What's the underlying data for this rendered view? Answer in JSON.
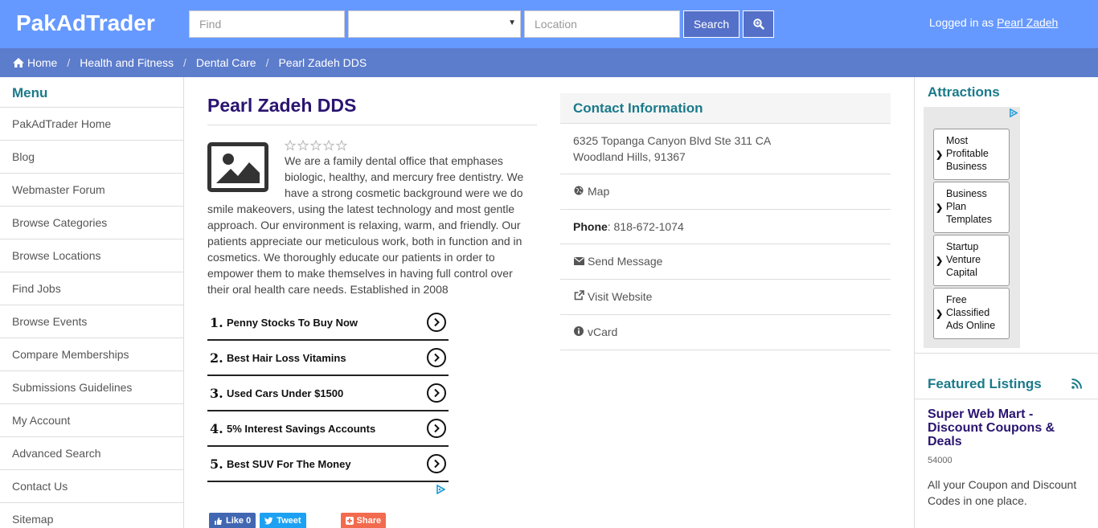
{
  "header": {
    "logo": "PakAdTrader",
    "find_placeholder": "Find",
    "category_selected": "",
    "location_placeholder": "Location",
    "search_label": "Search",
    "login_prefix": "Logged in as",
    "username": "Pearl Zadeh"
  },
  "breadcrumb": [
    "Home",
    "Health and Fitness",
    "Dental Care",
    "Pearl Zadeh DDS"
  ],
  "menu": {
    "title": "Menu",
    "items": [
      "PakAdTrader Home",
      "Blog",
      "Webmaster Forum",
      "Browse Categories",
      "Browse Locations",
      "Find Jobs",
      "Browse Events",
      "Compare Memberships",
      "Submissions Guidelines",
      "My Account",
      "Advanced Search",
      "Contact Us",
      "Sitemap"
    ]
  },
  "listing": {
    "title": "Pearl Zadeh DDS",
    "rating": 0,
    "description": "We are a family dental office that emphases biologic, healthy, and mercury free dentistry. We have a strong cosmetic background were we do smile makeovers, using the latest technology and most gentle approach. Our environment is relaxing, warm, and friendly. Our patients appreciate our meticulous work, both in function and in cosmetics. We thoroughly educate our patients in order to empower them to make themselves in having full control over their oral health care needs. Established in 2008"
  },
  "ads": [
    {
      "num": "1.",
      "label": "Penny Stocks To Buy Now"
    },
    {
      "num": "2.",
      "label": "Best Hair Loss Vitamins"
    },
    {
      "num": "3.",
      "label": "Used Cars Under $1500"
    },
    {
      "num": "4.",
      "label": "5% Interest Savings Accounts"
    },
    {
      "num": "5.",
      "label": "Best SUV For The Money"
    }
  ],
  "social": {
    "like": "Like 0",
    "tweet": "Tweet",
    "share": "Share"
  },
  "contact": {
    "title": "Contact Information",
    "address_line1": "6325 Topanga Canyon Blvd Ste 311 CA",
    "address_line2": "Woodland Hills, 91367",
    "map": "Map",
    "phone_label": "Phone",
    "phone": ": 818-672-1074",
    "message": "Send Message",
    "website": "Visit Website",
    "vcard": "vCard"
  },
  "attractions": {
    "title": "Attractions",
    "items": [
      [
        "Most",
        "Profitable",
        "Business"
      ],
      [
        "Business",
        "Plan",
        "Templates"
      ],
      [
        "Startup",
        "Venture",
        "Capital"
      ],
      [
        "Free",
        "Classified",
        "Ads Online"
      ]
    ]
  },
  "featured": {
    "title": "Featured Listings",
    "name": "Super Web Mart - Discount Coupons & Deals",
    "id": "54000",
    "desc": "All your Coupon and Discount Codes in one place."
  },
  "colors": {
    "topbar": "#6699ff",
    "crumbbar": "#5c7ccc",
    "button": "#5570c8",
    "heading": "#1a7a8a",
    "title": "#2a1470"
  }
}
